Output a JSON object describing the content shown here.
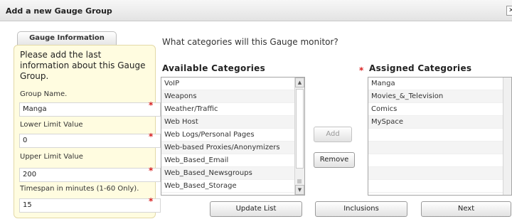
{
  "dialog": {
    "title": "Add a new Gauge Group",
    "close_icon": "close-icon"
  },
  "tab": {
    "label": "Gauge Information"
  },
  "panel": {
    "intro": "Please add the last information about this Gauge Group.",
    "fields": [
      {
        "label": "Group Name.",
        "value": "Manga"
      },
      {
        "label": "Lower Limit Value",
        "value": "0"
      },
      {
        "label": "Upper Limit Value",
        "value": "200"
      },
      {
        "label": "Timespan in minutes (1-60 Only).",
        "value": "15"
      }
    ],
    "required_mark": "*"
  },
  "question": "What categories will this Gauge monitor?",
  "available": {
    "heading": "Available Categories",
    "items": [
      "VoIP",
      "Weapons",
      "Weather/Traffic",
      "Web Host",
      "Web Logs/Personal Pages",
      "Web-based Proxies/Anonymizers",
      "Web_Based_Email",
      "Web_Based_Newsgroups",
      "Web_Based_Storage"
    ]
  },
  "assigned": {
    "heading": "Assigned Categories",
    "items": [
      "Manga",
      "Movies_&_Television",
      "Comics",
      "MySpace"
    ]
  },
  "buttons": {
    "add": "Add",
    "remove": "Remove",
    "update_list": "Update List",
    "inclusions": "Inclusions",
    "next": "Next"
  },
  "colors": {
    "required": "#d91f1f",
    "panel_bg": "#fffce0"
  }
}
